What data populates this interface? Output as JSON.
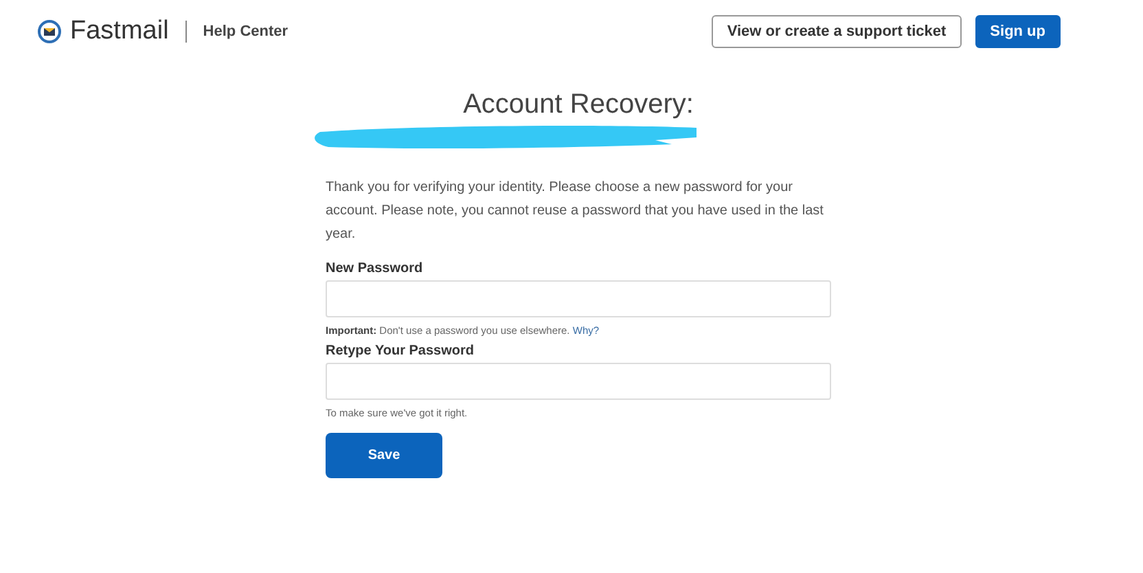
{
  "header": {
    "brand": "Fastmail",
    "section": "Help Center",
    "buttons": [
      {
        "label": "View or create a support ticket",
        "kind": "outline"
      },
      {
        "label": "Sign up",
        "kind": "primary"
      }
    ]
  },
  "page": {
    "title": "Account Recovery:",
    "intro": "Thank you for verifying your identity. Please choose a new password for your account. Please note, you cannot reuse a password that you have used in the last year."
  },
  "fields": [
    {
      "label": "New Password",
      "hint": "**Important:** Don't use a password you use elsewhere.",
      "hint_link": "Why?"
    },
    {
      "label": "Retype Your Password",
      "hint": "To make sure we've got it right."
    }
  ],
  "submit": {
    "label": "Save"
  }
}
